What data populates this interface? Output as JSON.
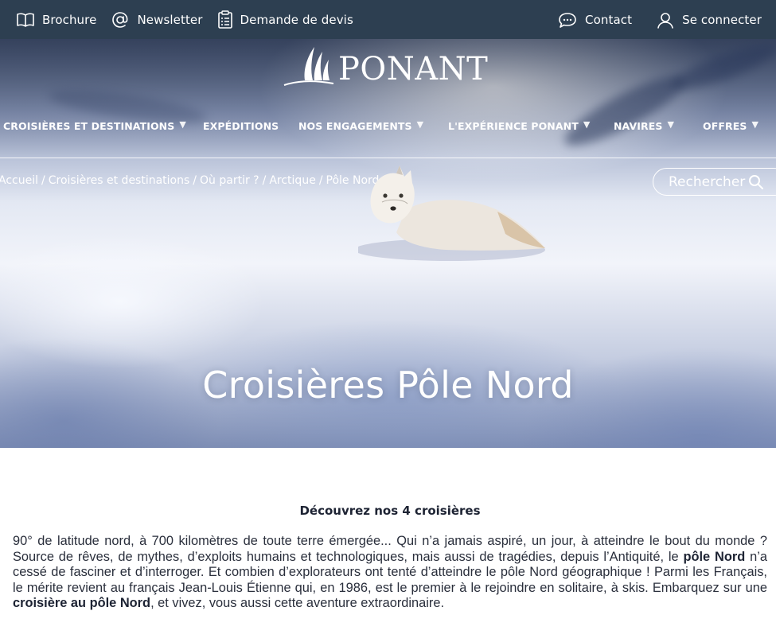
{
  "topbar": {
    "left": [
      {
        "label": "Brochure",
        "icon": "book-icon"
      },
      {
        "label": "Newsletter",
        "icon": "at-icon"
      },
      {
        "label": "Demande de devis",
        "icon": "clipboard-icon"
      }
    ],
    "right": [
      {
        "label": "Contact",
        "icon": "chat-icon"
      },
      {
        "label": "Se connecter",
        "icon": "user-icon"
      }
    ]
  },
  "brand": {
    "name": "PONANT"
  },
  "nav": {
    "items": [
      {
        "label": "CROISIÈRES ET DESTINATIONS",
        "dropdown": true
      },
      {
        "label": "EXPÉDITIONS",
        "dropdown": false
      },
      {
        "label": "NOS ENGAGEMENTS",
        "dropdown": true
      },
      {
        "label": "L'EXPÉRIENCE PONANT",
        "dropdown": true
      },
      {
        "label": "NAVIRES",
        "dropdown": true
      },
      {
        "label": "OFFRES",
        "dropdown": true
      }
    ],
    "caret": "▼"
  },
  "breadcrumb": {
    "items": [
      "Accueil",
      "Croisières et destinations",
      "Où partir ?",
      "Arctique",
      "Pôle Nord"
    ],
    "separator": "/"
  },
  "search": {
    "label": "Rechercher"
  },
  "hero": {
    "title": "Croisières Pôle Nord"
  },
  "intro": {
    "heading": "Découvrez nos 4 croisières",
    "p1": "90° de latitude nord, à 700 kilomètres de toute terre émergée... Qui n’a jamais aspiré, un jour, à atteindre le bout du monde ? Source de rêves, de mythes, d’exploits humains et technologiques, mais aussi de tragédies, depuis l’Antiquité, le ",
    "b1": "pôle Nord",
    "p2": " n’a cessé de fasciner et d’interroger. Et combien d’explorateurs ont tenté d’atteindre le pôle Nord géographique ! Parmi les Français, le mérite revient au français Jean-Louis Étienne qui, en 1986, est le premier à le rejoindre en solitaire, à skis. Embarquez sur une ",
    "b2": "croisière au pôle Nord",
    "p3": ", et vivez, vous aussi cette aventure extraordinaire."
  },
  "colors": {
    "topbar": "#2d3f51",
    "text": "#1d2333",
    "white": "#ffffff"
  }
}
